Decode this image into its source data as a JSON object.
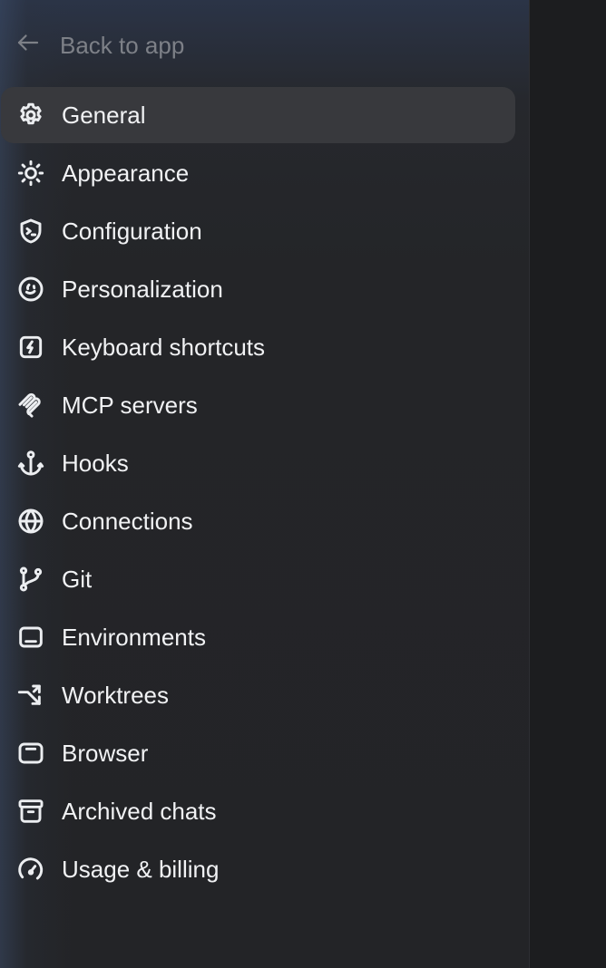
{
  "back": {
    "label": "Back to app",
    "icon": "arrow-left-icon"
  },
  "nav": {
    "active_index": 0,
    "items": [
      {
        "label": "General",
        "icon": "gear-icon"
      },
      {
        "label": "Appearance",
        "icon": "sun-icon"
      },
      {
        "label": "Configuration",
        "icon": "shield-terminal-icon"
      },
      {
        "label": "Personalization",
        "icon": "smiley-icon"
      },
      {
        "label": "Keyboard shortcuts",
        "icon": "bolt-square-icon"
      },
      {
        "label": "MCP servers",
        "icon": "mcp-icon"
      },
      {
        "label": "Hooks",
        "icon": "anchor-icon"
      },
      {
        "label": "Connections",
        "icon": "globe-icon"
      },
      {
        "label": "Git",
        "icon": "git-branch-icon"
      },
      {
        "label": "Environments",
        "icon": "monitor-icon"
      },
      {
        "label": "Worktrees",
        "icon": "worktree-arrow-icon"
      },
      {
        "label": "Browser",
        "icon": "browser-window-icon"
      },
      {
        "label": "Archived chats",
        "icon": "archive-box-icon"
      },
      {
        "label": "Usage & billing",
        "icon": "gauge-icon"
      }
    ]
  },
  "colors": {
    "sidebar_bg": "#242528",
    "active_bg": "#38393d",
    "text": "#f1f2f4",
    "muted_text": "#7d8087",
    "right_pane_bg": "#1c1d1f"
  }
}
